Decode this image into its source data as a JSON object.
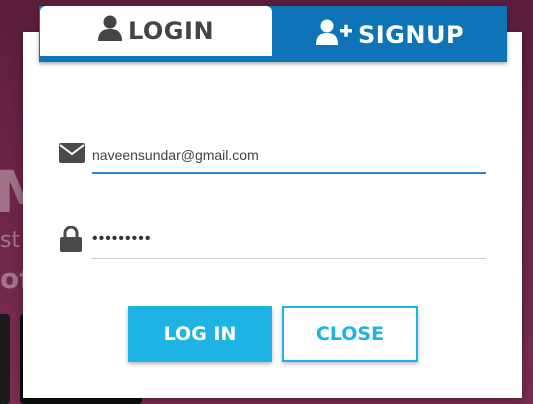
{
  "background": {
    "big_text": "M",
    "mid_text": "st",
    "low_text": "of"
  },
  "tabs": {
    "login_label": "LOGIN",
    "signup_label": "SIGNUP",
    "login_icon": "user-icon",
    "signup_icon": "user-plus-icon"
  },
  "form": {
    "email_icon": "envelope-icon",
    "email_value": "naveensundar@gmail.com",
    "password_icon": "lock-icon",
    "password_value": "•••••••••"
  },
  "buttons": {
    "login_label": "LOG IN",
    "close_label": "CLOSE"
  },
  "colors": {
    "accent": "#1fb3e3",
    "tab_bar": "#0e74b8",
    "focus_underline": "#2a87c9"
  }
}
